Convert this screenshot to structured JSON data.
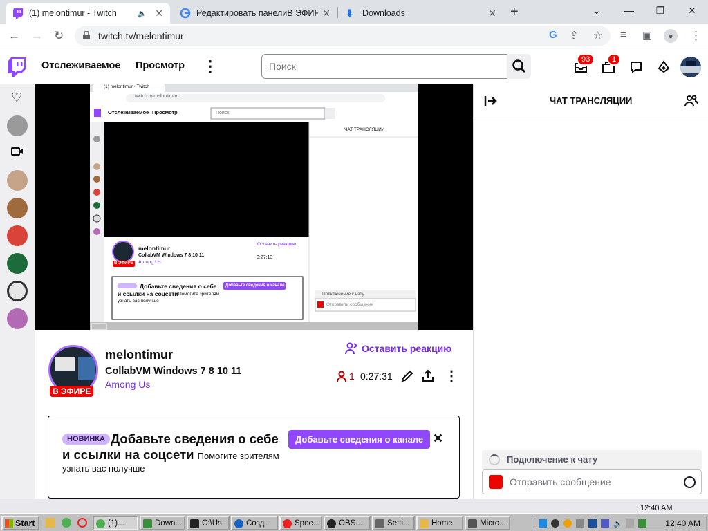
{
  "browser": {
    "tabs": [
      {
        "title": "(1) melontimur - Twitch",
        "active": true
      },
      {
        "title": "Редактировать панелиВ ЭФИРЕ",
        "active": false
      },
      {
        "title": "Downloads",
        "active": false
      }
    ],
    "url": "twitch.tv/melontimur"
  },
  "twitch": {
    "nav_following": "Отслеживаемое",
    "nav_browse": "Просмотр",
    "search_placeholder": "Поиск",
    "notifications_count": "93",
    "inbox_count": "1"
  },
  "channel": {
    "name": "melontimur",
    "title": "CollabVM Windows 7 8 10 11",
    "game": "Among Us",
    "live_label": "В ЭФИРЕ",
    "react_label": "Оставить реакцию",
    "viewers": "1",
    "uptime": "0:27:31"
  },
  "info_card": {
    "badge": "НОВИНКА",
    "heading": "Добавьте сведения о себе и ссылки на соцсети",
    "sub_inline": "Помогите зрителям",
    "sub_next": "узнать вас получше",
    "button": "Добавьте сведения о канале"
  },
  "chat": {
    "title": "ЧАТ ТРАНСЛЯЦИИ",
    "connecting": "Подключение к чату",
    "placeholder": "Отправить сообщение"
  },
  "taskbar": {
    "start": "Start",
    "buttons": [
      "(1)...",
      "Down...",
      "C:\\Us...",
      "Созд...",
      "Spee...",
      "OBS...",
      "Setti...",
      "Home",
      "Micro..."
    ],
    "clock": "12:40 AM",
    "clock_top": "12:40 AM"
  },
  "inner_video": {
    "url": "twitch.tv/melontimur",
    "nav_following": "Отслеживаемое",
    "nav_browse": "Просмотр",
    "search": "Поиск",
    "chat_title": "ЧАТ ТРАНСЛЯЦИИ",
    "name": "melontimur",
    "title": "CollabVM Windows 7 8 10 11",
    "game": "Among Us",
    "live": "В ЭФИРЕ",
    "react": "Оставить реакцию",
    "uptime": "0:27:13",
    "card_heading": "Добавьте сведения о себе",
    "card_heading2": "и ссылки на соцсети",
    "card_btn": "Добавьте сведения о канале",
    "card_sub": "Помогите зрителям",
    "card_sub2": "узнать вас получше",
    "connecting": "Подключение к чату",
    "placeholder": "Отправить сообщение"
  }
}
